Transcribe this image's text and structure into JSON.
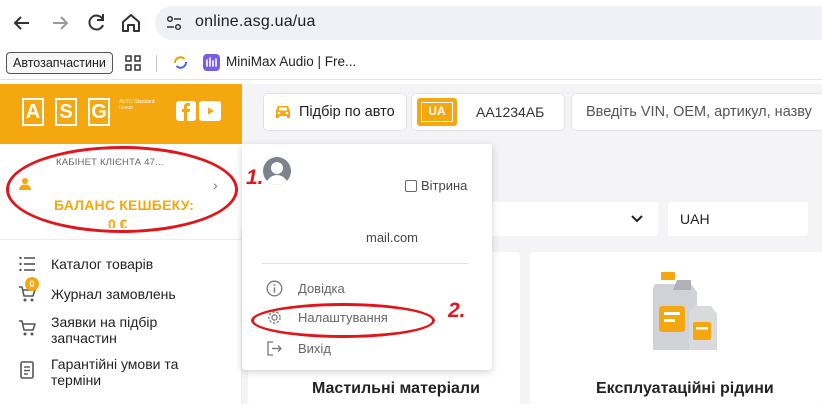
{
  "browser": {
    "url": "online.asg.ua/ua",
    "bookmarks": {
      "folder_label": "Автозапчастини",
      "minimax_label": "MiniMax Audio | Fre..."
    }
  },
  "header": {
    "logo_letters": [
      "A",
      "S",
      "G"
    ],
    "logo_subtitle": "AUTO Standard Group",
    "pick_by_car_label": "Підбір по авто",
    "plate_country": "UA",
    "plate_number": "AA1234АБ",
    "search_placeholder": "Введіть VIN, OEM, артикул, назву"
  },
  "sidebar": {
    "cabinet_label": "КАБІНЕТ КЛІЄНТА 47...",
    "cashback_label": "БАЛАНС КЕШБЕКУ:",
    "cashback_value": "0 €",
    "items": [
      {
        "label": "Каталог товарів"
      },
      {
        "label": "Журнал замовлень",
        "badge": "0"
      },
      {
        "label": "Заявки на підбір запчастин"
      },
      {
        "label": "Гарантійні умови та терміни"
      }
    ]
  },
  "main": {
    "currency_value": "UAH",
    "cards": [
      {
        "title": "Мастильні матеріали"
      },
      {
        "title": "Експлуатаційні рідини"
      }
    ]
  },
  "dropdown": {
    "showcase_label": "Вітрина",
    "email": "mail.com",
    "items": [
      {
        "label": "Довідка"
      },
      {
        "label": "Налаштування"
      },
      {
        "label": "Вихід"
      }
    ]
  },
  "annotations": {
    "step1": "1.",
    "step2": "2."
  },
  "colors": {
    "brand_orange": "#f5a70f",
    "annotation_red": "#e0161b"
  }
}
